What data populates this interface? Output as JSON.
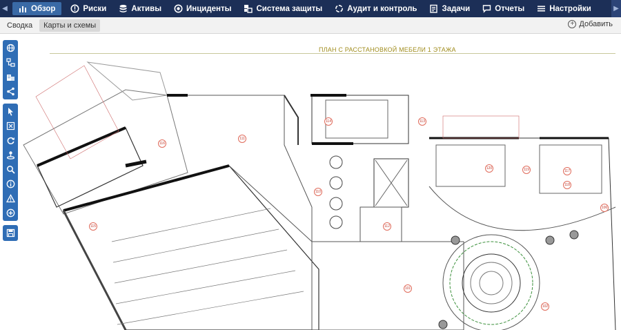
{
  "nav": {
    "items": [
      {
        "label": "Обзор",
        "icon": "chart-icon",
        "active": true
      },
      {
        "label": "Риски",
        "icon": "alert-circle-icon"
      },
      {
        "label": "Активы",
        "icon": "database-icon"
      },
      {
        "label": "Инциденты",
        "icon": "target-icon"
      },
      {
        "label": "Система защиты",
        "icon": "shield-grid-icon"
      },
      {
        "label": "Аудит и контроль",
        "icon": "cycle-icon"
      },
      {
        "label": "Задачи",
        "icon": "clipboard-icon"
      },
      {
        "label": "Отчеты",
        "icon": "chat-icon"
      },
      {
        "label": "Настройки",
        "icon": "menu-icon"
      }
    ]
  },
  "subbar": {
    "tabs": [
      {
        "label": "Сводка",
        "active": false
      },
      {
        "label": "Карты и схемы",
        "active": true
      }
    ],
    "add_label": "Добавить"
  },
  "tools": {
    "group1": [
      "globe-icon",
      "link-nodes-icon",
      "building-icon",
      "share-icon"
    ],
    "group2": [
      "pointer-icon",
      "fit-icon",
      "refresh-icon",
      "user-pin-icon",
      "zoom-icon",
      "info-icon",
      "warning-icon",
      "add-circle-icon"
    ],
    "group3": [
      "save-icon"
    ]
  },
  "plan": {
    "title": "ПЛАН С РАССТАНОВКОЙ МЕБЕЛИ 1 ЭТАЖА",
    "rooms": [
      {
        "label": "116"
      },
      {
        "label": "111"
      },
      {
        "label": "115"
      },
      {
        "label": "110"
      },
      {
        "label": "114"
      },
      {
        "label": "113"
      },
      {
        "label": "112"
      },
      {
        "label": "101"
      },
      {
        "label": "120"
      },
      {
        "label": "119"
      },
      {
        "label": "117"
      },
      {
        "label": "118"
      },
      {
        "label": "106"
      },
      {
        "label": "102"
      }
    ]
  },
  "colors": {
    "nav_bg": "#1c2f57",
    "nav_active": "#3a6aa6",
    "tool_bg": "#2f6db5",
    "title_color": "#a08c1c"
  }
}
